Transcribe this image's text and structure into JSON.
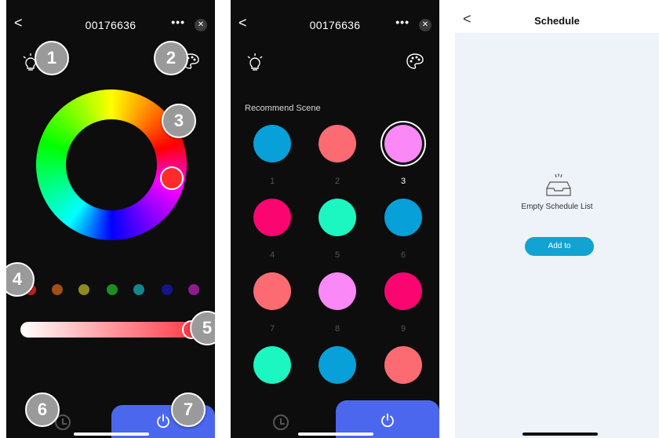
{
  "screen1": {
    "title": "00176636",
    "back_label": "<",
    "more_label": "•••",
    "close_label": "✕",
    "badges": [
      "1",
      "2",
      "3",
      "4",
      "5",
      "6",
      "7"
    ],
    "presets": [
      "#c0211d",
      "#a24f18",
      "#8f8c1f",
      "#1c8e26",
      "#12868c",
      "#12158c",
      "#8e1d8c"
    ],
    "selected_color": "#ff2b2b",
    "brightness_percent": 100
  },
  "screen2": {
    "title": "00176636",
    "back_label": "<",
    "more_label": "•••",
    "close_label": "✕",
    "section_title": "Recommend Scene",
    "scenes": [
      {
        "num": "1",
        "color": "#07a0d8",
        "selected": false
      },
      {
        "num": "2",
        "color": "#fc6b72",
        "selected": false
      },
      {
        "num": "3",
        "color": "#fb88f7",
        "selected": true
      },
      {
        "num": "4",
        "color": "#fb0570",
        "selected": false
      },
      {
        "num": "5",
        "color": "#1cf6c0",
        "selected": false
      },
      {
        "num": "6",
        "color": "#07a0d8",
        "selected": false
      },
      {
        "num": "7",
        "color": "#fc6b72",
        "selected": false
      },
      {
        "num": "8",
        "color": "#fb88f7",
        "selected": false
      },
      {
        "num": "9",
        "color": "#fb0570",
        "selected": false
      },
      {
        "num": "",
        "color": "#1cf6c0",
        "selected": false
      },
      {
        "num": "",
        "color": "#07a0d8",
        "selected": false
      },
      {
        "num": "",
        "color": "#fc6b72",
        "selected": false
      }
    ]
  },
  "screen3": {
    "title": "Schedule",
    "back_label": "<",
    "empty_text": "Empty Schedule List",
    "add_label": "Add to"
  },
  "colors": {
    "power_accent": "#4a67ee",
    "add_button": "#11a3d1"
  }
}
